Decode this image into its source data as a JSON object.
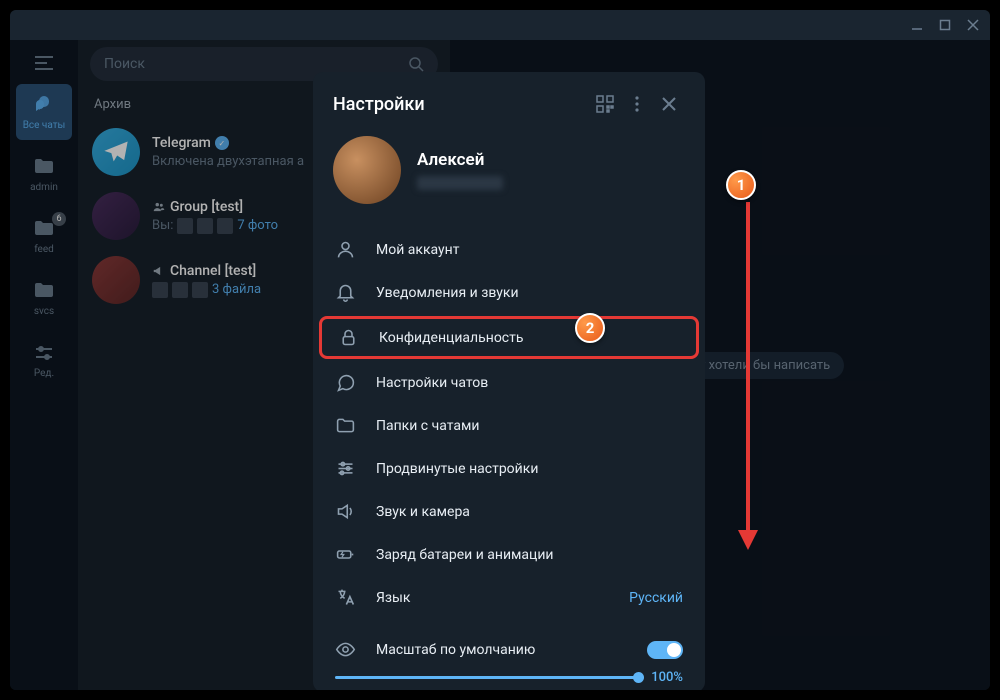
{
  "titlebar": {},
  "rail": {
    "items": [
      {
        "label": "Все чаты"
      },
      {
        "label": "admin"
      },
      {
        "label": "feed",
        "badge": "6"
      },
      {
        "label": "svcs"
      },
      {
        "label": "Ред."
      }
    ]
  },
  "search": {
    "placeholder": "Поиск"
  },
  "archive_label": "Архив",
  "chats": [
    {
      "title": "Telegram",
      "verified": true,
      "sub": "Включена двухэтапная а"
    },
    {
      "title": "Group [test]",
      "prefix": "Вы:",
      "sub": "7 фото"
    },
    {
      "title": "Channel [test]",
      "sub": "3 файла"
    }
  ],
  "placeholder_text": "Выберите, кому хотели бы написать",
  "modal": {
    "title": "Настройки",
    "profile": {
      "name": "Алексей"
    },
    "items": [
      {
        "label": "Мой аккаунт"
      },
      {
        "label": "Уведомления и звуки"
      },
      {
        "label": "Конфиденциальность"
      },
      {
        "label": "Настройки чатов"
      },
      {
        "label": "Папки с чатами"
      },
      {
        "label": "Продвинутые настройки"
      },
      {
        "label": "Звук и камера"
      },
      {
        "label": "Заряд батареи и анимации"
      },
      {
        "label": "Язык",
        "value": "Русский"
      }
    ],
    "scale": {
      "label": "Масштаб по умолчанию",
      "value": "100%"
    }
  },
  "annotations": {
    "badge1": "1",
    "badge2": "2"
  }
}
